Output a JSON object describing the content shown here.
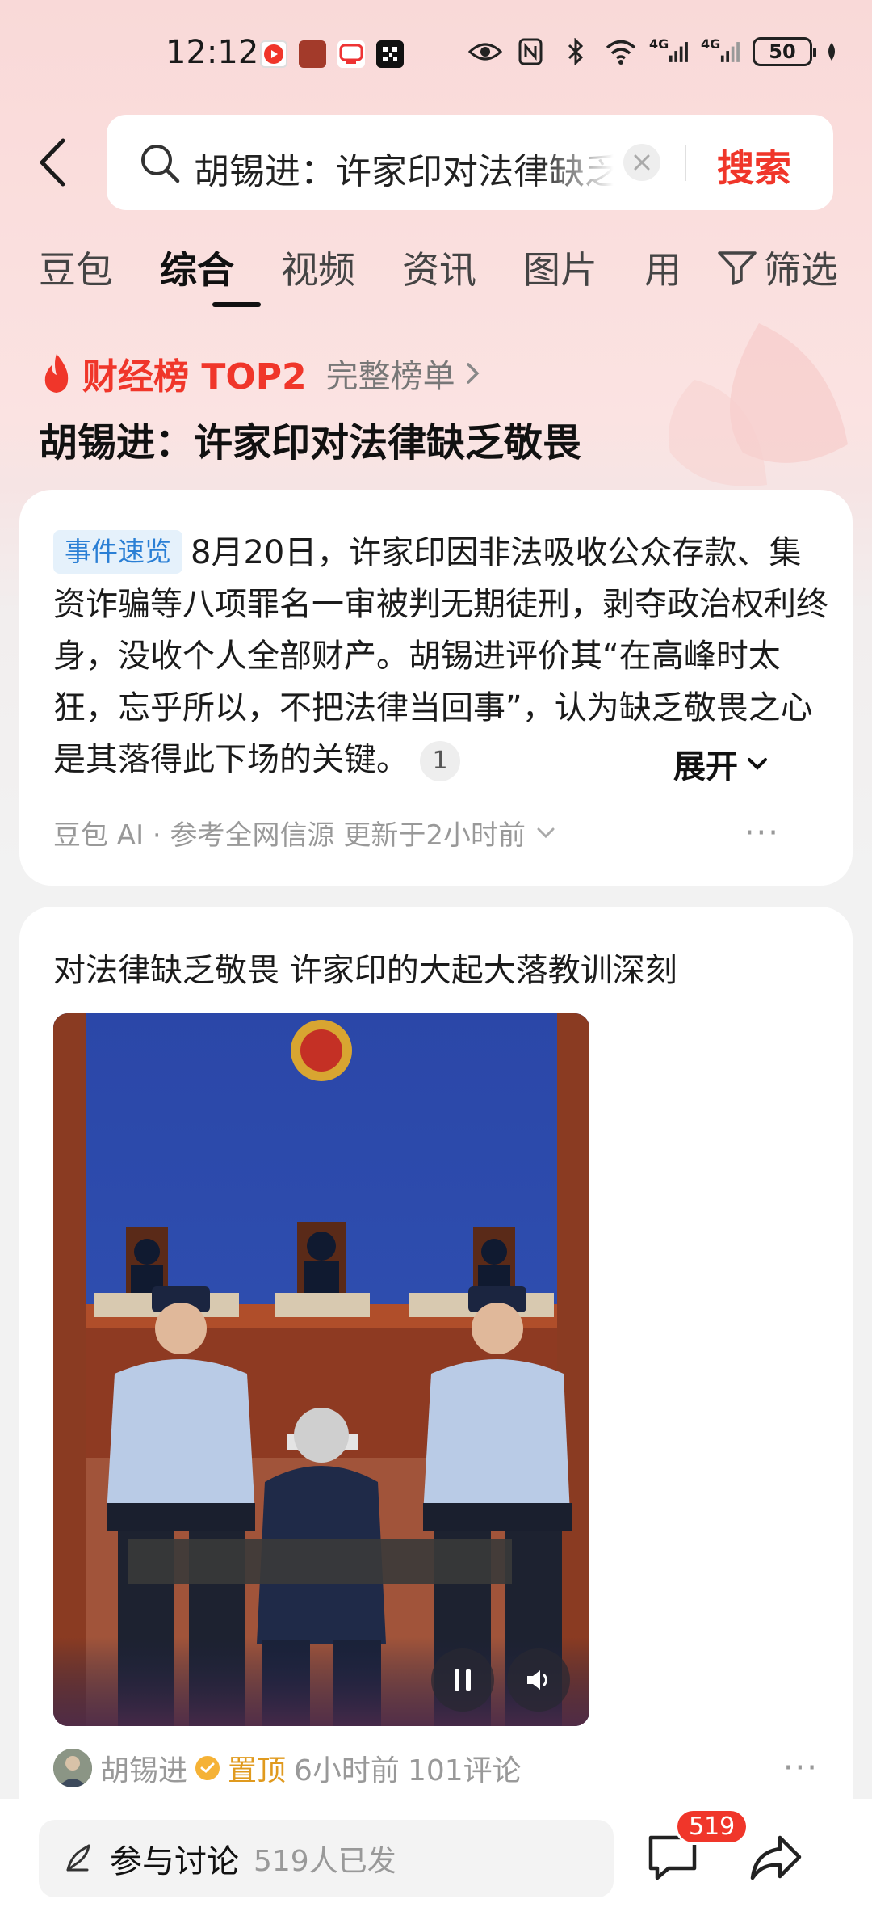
{
  "status_bar": {
    "time": "12:12",
    "battery": "50",
    "network_1": "4G",
    "network_2": "4G"
  },
  "search": {
    "query": "胡锡进：许家印对法律缺乏敬畏",
    "submit_label": "搜索"
  },
  "tabs": {
    "items": [
      "豆包",
      "综合",
      "视频",
      "资讯",
      "图片",
      "用"
    ],
    "active": "综合",
    "filter_label": "筛选"
  },
  "ranking": {
    "label": "财经榜 TOP2",
    "more_label": "完整榜单",
    "topic": "胡锡进：许家印对法律缺乏敬畏"
  },
  "ai_summary": {
    "badge": "事件速览",
    "text": "8月20日，许家印因非法吸收公众存款、集资诈骗等八项罪名一审被判无期徒刑，剥夺政治权利终身，没收个人全部财产。胡锡进评价其“在高峰时太狂，忘乎所以，不把法律当回事”，认为缺乏敬畏之心是其落得此下场的关键。",
    "ref_count": "1",
    "expand_label": "展开",
    "footer": "豆包 AI · 参考全网信源 更新于2小时前"
  },
  "video_post": {
    "title": "对法律缺乏敬畏 许家印的大起大落教训深刻",
    "author": "胡锡进",
    "pinned_label": "置顶",
    "time": "6小时前",
    "comments": "101评论"
  },
  "bottom_bar": {
    "discuss_label": "参与讨论",
    "discuss_count": "519人已发",
    "comment_badge": "519"
  },
  "colors": {
    "accent": "#f0362a",
    "badge_blue": "#2a7fd5",
    "pin_gold": "#e09a1e"
  }
}
